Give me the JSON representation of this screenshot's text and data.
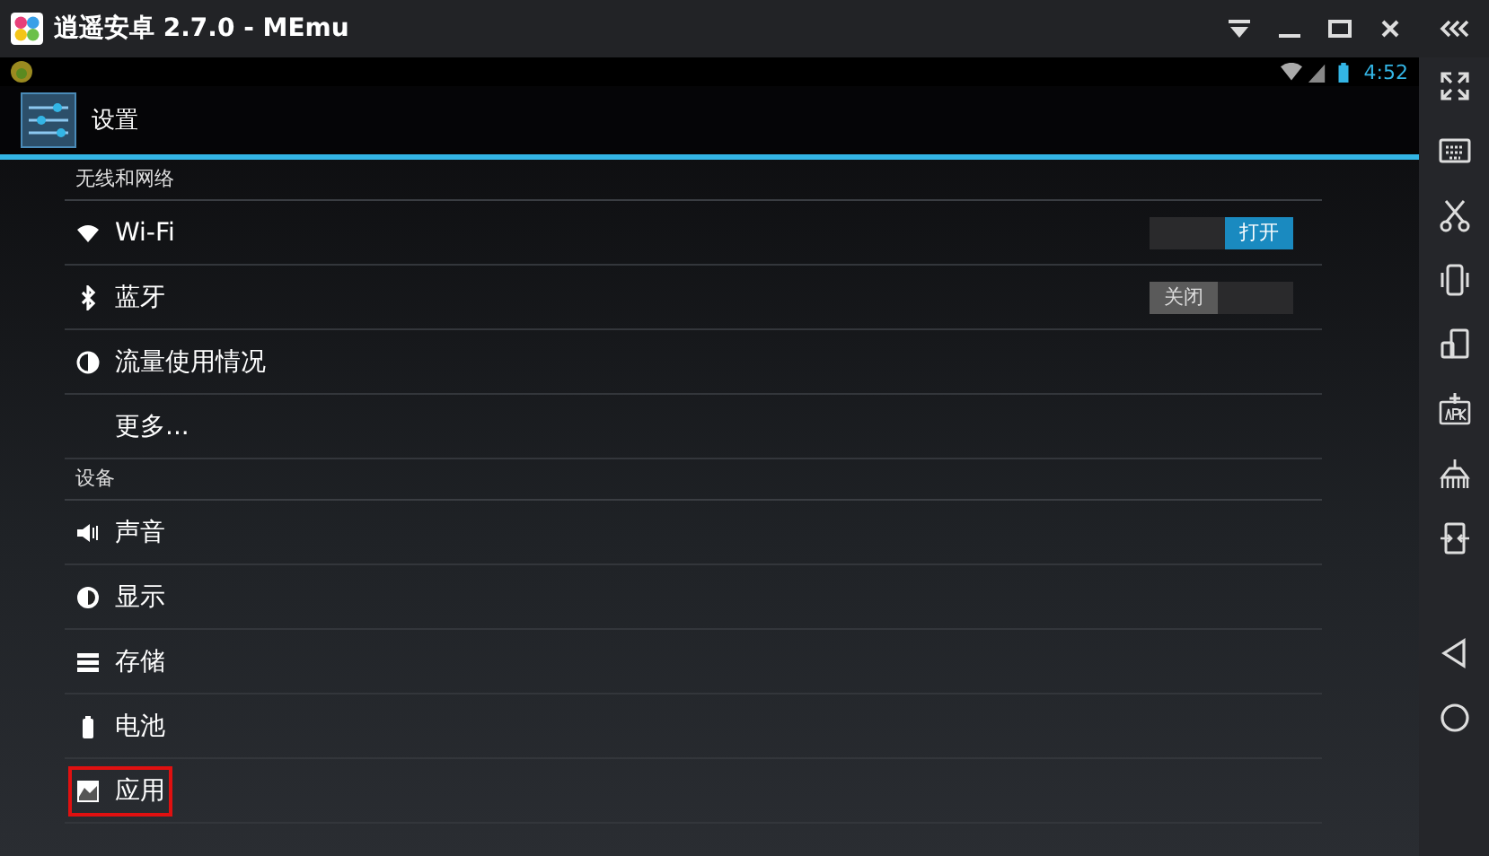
{
  "window": {
    "title": "逍遥安卓 2.7.0 - MEmu"
  },
  "status_bar": {
    "time": "4:52"
  },
  "action_bar": {
    "title": "设置"
  },
  "sections": [
    {
      "header": "无线和网络",
      "items": [
        {
          "label": "Wi-Fi",
          "kind": "switch",
          "switch": {
            "on": true,
            "label": "打开"
          },
          "highlighted": false
        },
        {
          "label": "蓝牙",
          "kind": "switch",
          "switch": {
            "on": false,
            "label": "关闭"
          },
          "highlighted": false
        },
        {
          "label": "流量使用情况",
          "kind": "plain",
          "highlighted": false
        },
        {
          "label": "更多...",
          "kind": "plain",
          "highlighted": false
        }
      ]
    },
    {
      "header": "设备",
      "items": [
        {
          "label": "声音",
          "kind": "plain",
          "highlighted": false
        },
        {
          "label": "显示",
          "kind": "plain",
          "highlighted": false
        },
        {
          "label": "存储",
          "kind": "plain",
          "highlighted": false
        },
        {
          "label": "电池",
          "kind": "plain",
          "highlighted": false
        },
        {
          "label": "应用",
          "kind": "plain",
          "highlighted": true
        }
      ]
    }
  ]
}
